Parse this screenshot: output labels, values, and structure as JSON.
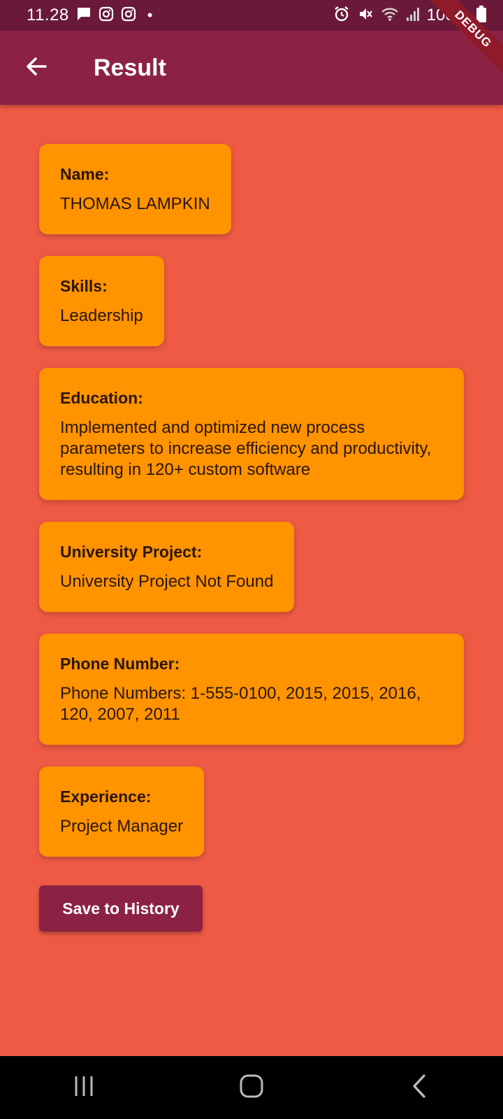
{
  "status_bar": {
    "time": "11.28",
    "battery": "100%",
    "icons": [
      "message-icon",
      "instagram-icon",
      "instagram-icon",
      "dot-icon",
      "alarm-icon",
      "mute-icon",
      "wifi-icon",
      "signal-icon",
      "battery-icon"
    ]
  },
  "app_bar": {
    "title": "Result",
    "back_icon": "arrow-left-icon"
  },
  "debug_banner": "DEBUG",
  "cards": [
    {
      "label": "Name:",
      "value": "THOMAS LAMPKIN"
    },
    {
      "label": "Skills:",
      "value": "Leadership"
    },
    {
      "label": "Education:",
      "value": "Implemented and optimized new process parameters to increase efficiency and productivity, resulting in 120+ custom software"
    },
    {
      "label": "University Project:",
      "value": "University Project Not Found"
    },
    {
      "label": "Phone Number:",
      "value": "Phone Numbers: 1-555-0100, 2015, 2015, 2016, 120, 2007, 2011"
    },
    {
      "label": "Experience:",
      "value": "Project Manager"
    }
  ],
  "save_button": "Save to History",
  "nav_bar": {
    "icons": [
      "recents-icon",
      "home-icon",
      "back-icon"
    ]
  },
  "colors": {
    "background": "#EF5A45",
    "status_bar": "#6A1A38",
    "app_bar": "#8B2244",
    "card": "#FF9300",
    "button": "#8B2244"
  }
}
